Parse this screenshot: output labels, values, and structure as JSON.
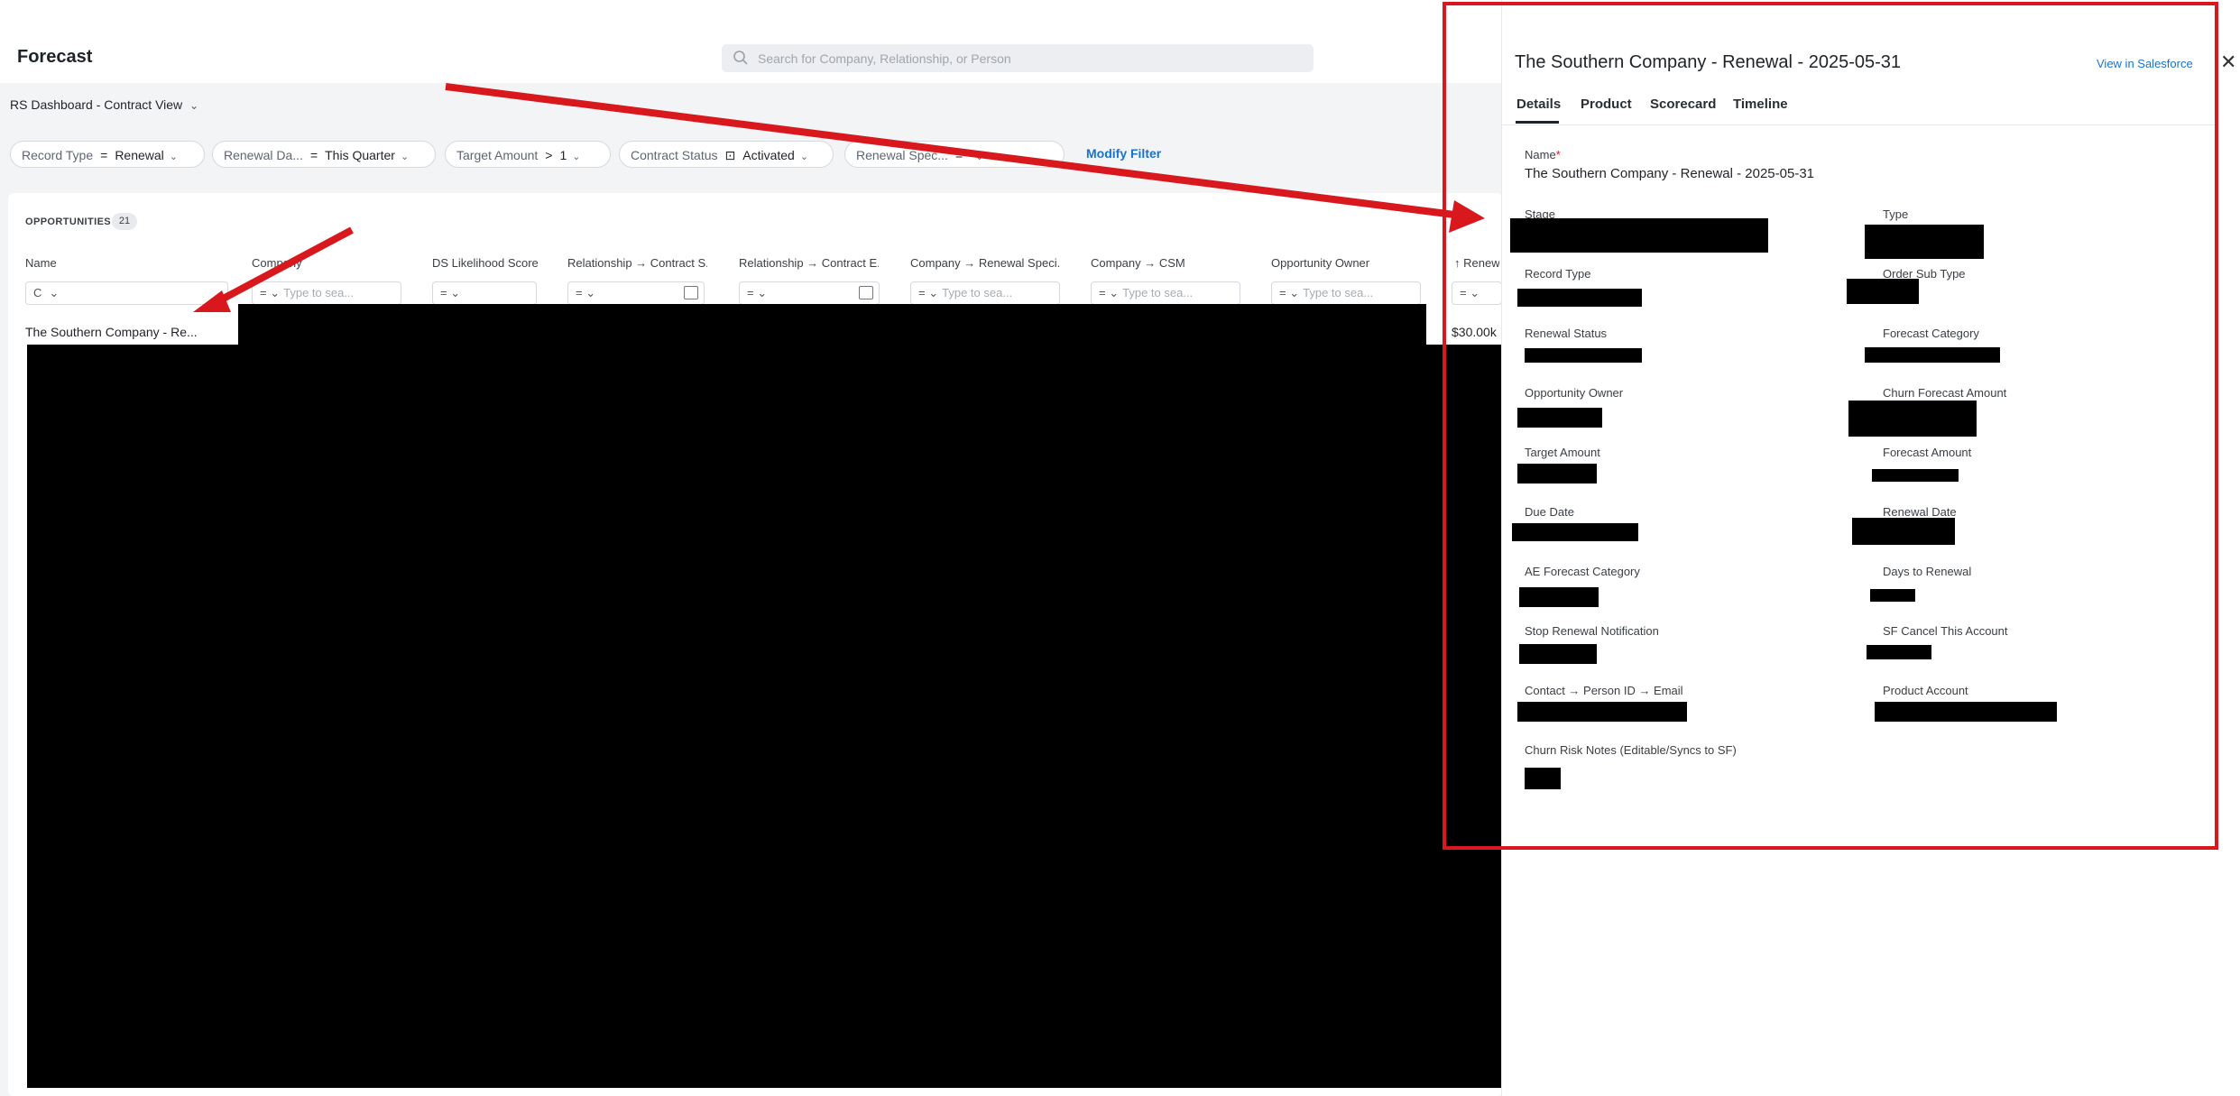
{
  "header": {
    "page_title": "Forecast",
    "search_placeholder": "Search for Company, Relationship, or Person"
  },
  "dashboard": {
    "view_name": "RS Dashboard - Contract View"
  },
  "filters": [
    {
      "label": "Record Type",
      "op": "=",
      "value": "Renewal"
    },
    {
      "label": "Renewal Da...",
      "op": "=",
      "value": "This Quarter"
    },
    {
      "label": "Target Amount",
      "op": ">",
      "value": "1"
    },
    {
      "label": "Contract Status",
      "op": "⊡",
      "value": "Activated"
    },
    {
      "label": "Renewal Spec...",
      "op": "=",
      "value": ""
    }
  ],
  "modify_filter_label": "Modify Filter",
  "table": {
    "section_label": "OPPORTUNITIES",
    "count": "21",
    "columns": [
      {
        "header": "Name",
        "filter_op": "C",
        "placeholder": ""
      },
      {
        "header": "Company",
        "filter_op": "=",
        "placeholder": "Type to sea..."
      },
      {
        "header": "DS Likelihood Score",
        "filter_op": "=",
        "placeholder": ""
      },
      {
        "header": "Relationship → Contract S...",
        "filter_op": "=",
        "placeholder": ""
      },
      {
        "header": "Relationship → Contract E...",
        "filter_op": "=",
        "placeholder": ""
      },
      {
        "header": "Company → Renewal Speci...",
        "filter_op": "=",
        "placeholder": "Type to sea..."
      },
      {
        "header": "Company → CSM",
        "filter_op": "=",
        "placeholder": "Type to sea..."
      },
      {
        "header": "Opportunity Owner",
        "filter_op": "=",
        "placeholder": "Type to sea..."
      },
      {
        "header": "↑ Renew",
        "filter_op": "=",
        "placeholder": ""
      }
    ],
    "rows": [
      {
        "name": "The Southern Company - Re...",
        "amount": "$30.00k"
      }
    ]
  },
  "detail": {
    "title": "The Southern Company - Renewal - 2025-05-31",
    "view_in_sf": "View in Salesforce",
    "close_glyph": "✕",
    "tabs": [
      "Details",
      "Product",
      "Scorecard",
      "Timeline"
    ],
    "active_tab": "Details",
    "name_label": "Name",
    "name_required": "*",
    "name_value": "The Southern Company - Renewal - 2025-05-31",
    "fields_left": [
      "Stage",
      "Record Type",
      "Renewal Status",
      "Opportunity Owner",
      "Target Amount",
      "Due Date",
      "AE Forecast Category",
      "Stop Renewal Notification",
      "Contact → Person ID → Email",
      "Churn Risk Notes (Editable/Syncs to SF)"
    ],
    "fields_right": [
      "Type",
      "Order Sub Type",
      "Forecast Category",
      "Churn Forecast Amount",
      "Forecast Amount",
      "Renewal Date",
      "Days to Renewal",
      "SF Cancel This Account",
      "Product Account"
    ]
  },
  "colors": {
    "accent": "#1a73c8",
    "annotation_red": "#d8181c",
    "redaction": "#000000"
  },
  "icons": [
    "search-icon",
    "chevron-down-icon",
    "calendar-icon",
    "close-icon",
    "sort-up-icon"
  ]
}
